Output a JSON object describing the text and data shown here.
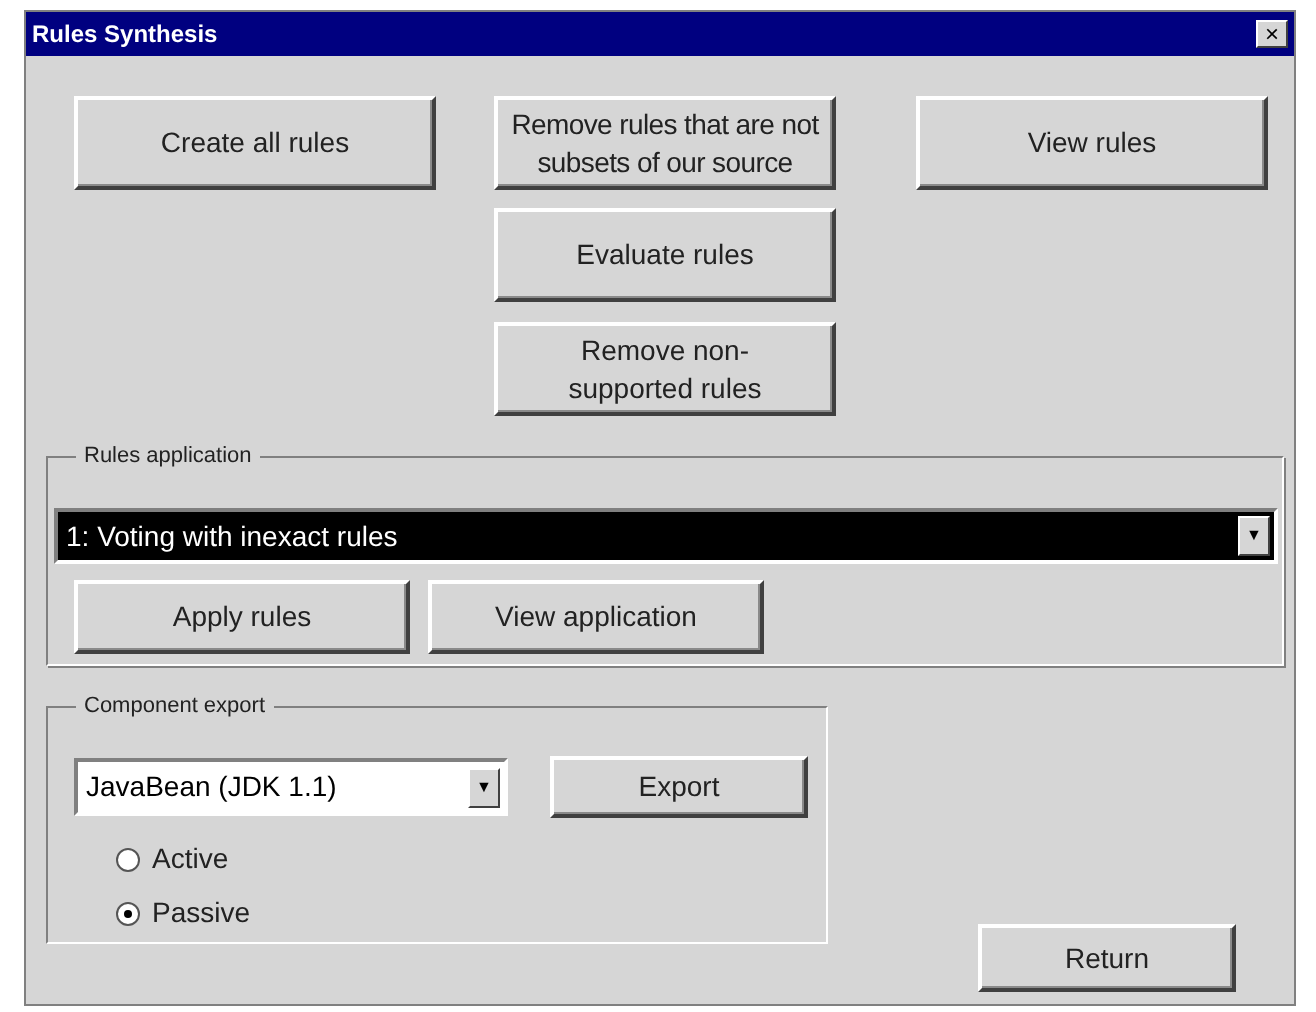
{
  "window": {
    "title": "Rules Synthesis",
    "close": "×"
  },
  "top_buttons": [
    {
      "label": "Create all rules"
    },
    {
      "label": "Remove rules that are not subsets of our source"
    },
    {
      "label": "View rules"
    }
  ],
  "middle_buttons": [
    {
      "label": "Evaluate rules"
    },
    {
      "label": "Remove non-supported rules"
    }
  ],
  "rules_application": {
    "title": "Rules application",
    "dropdown": {
      "value": "1: Voting with inexact rules",
      "arrow": "▼"
    },
    "buttons": [
      {
        "label": "Apply rules"
      },
      {
        "label": "View application"
      }
    ]
  },
  "component_export": {
    "title": "Component export",
    "dropdown": {
      "value": "JavaBean (JDK 1.1)",
      "arrow": "▼"
    },
    "button": {
      "label": "Export"
    },
    "options": [
      {
        "label": "Active",
        "selected": false
      },
      {
        "label": "Passive",
        "selected": true
      }
    ]
  },
  "return_button": {
    "label": "Return"
  }
}
